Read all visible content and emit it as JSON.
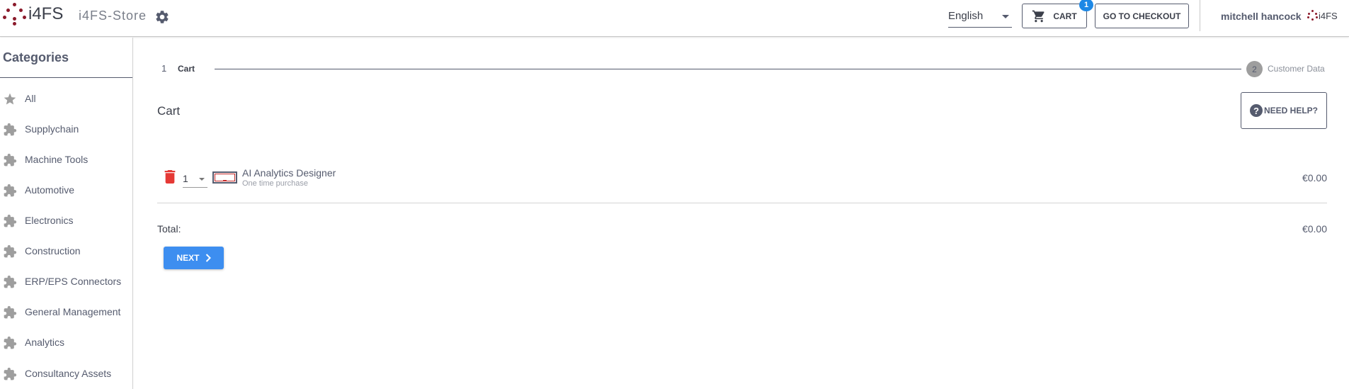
{
  "header": {
    "logo_text": "i4FS",
    "store_name": "i4FS-Store",
    "language": "English",
    "cart_label": "CART",
    "cart_count": "1",
    "checkout_label": "GO TO CHECKOUT",
    "user_name": "mitchell hancock",
    "small_logo_text": "i4FS",
    "brand_color": "#8b1a2b",
    "accent_color": "#1e88e5"
  },
  "sidebar": {
    "title": "Categories",
    "items": [
      {
        "label": "All",
        "icon": "star-icon"
      },
      {
        "label": "Supplychain",
        "icon": "puzzle-icon"
      },
      {
        "label": "Machine Tools",
        "icon": "puzzle-icon"
      },
      {
        "label": "Automotive",
        "icon": "puzzle-icon"
      },
      {
        "label": "Electronics",
        "icon": "puzzle-icon"
      },
      {
        "label": "Construction",
        "icon": "puzzle-icon"
      },
      {
        "label": "ERP/EPS Connectors",
        "icon": "puzzle-icon"
      },
      {
        "label": "General Management",
        "icon": "puzzle-icon"
      },
      {
        "label": "Analytics",
        "icon": "puzzle-icon"
      },
      {
        "label": "Consultancy Assets",
        "icon": "puzzle-icon"
      }
    ]
  },
  "stepper": {
    "step1_number": "1",
    "step1_label": "Cart",
    "step2_number": "2",
    "step2_label": "Customer Data"
  },
  "cart": {
    "title": "Cart",
    "help_label": "NEED HELP?",
    "item": {
      "quantity": "1",
      "name": "AI Analytics Designer",
      "subtitle": "One time purchase",
      "price": "€0.00"
    },
    "total_label": "Total:",
    "total_value": "€0.00",
    "next_label": "NEXT",
    "delete_color": "#e53935",
    "next_color": "#3d8ef0"
  }
}
